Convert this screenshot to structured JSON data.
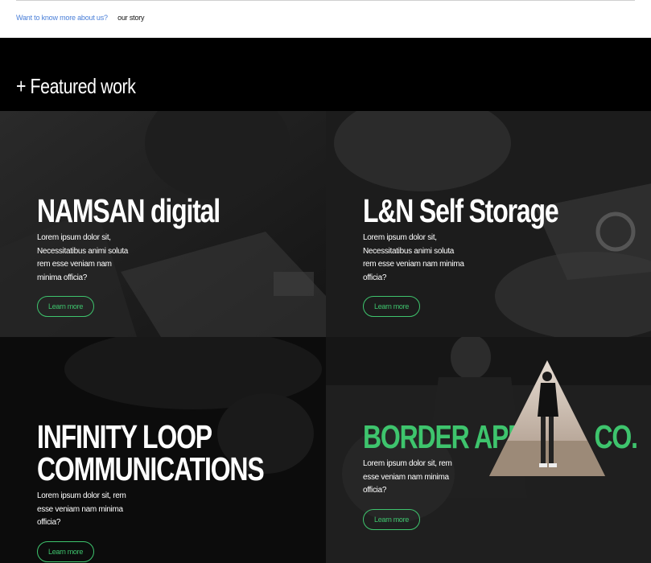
{
  "topbar": {
    "ask": "Want to know more about us?",
    "story": "our story"
  },
  "section": {
    "heading": "+ Featured work"
  },
  "cards": [
    {
      "title_lines": [
        "NAMSAN digital"
      ],
      "desc_lines": [
        "Lorem ipsum dolor sit,",
        "Necessitatibus animi soluta",
        "rem esse veniam nam",
        "minima officia?"
      ],
      "button": "Learn more"
    },
    {
      "title_lines": [
        "L&N Self Storage"
      ],
      "desc_lines": [
        "Lorem ipsum dolor sit,",
        "Necessitatibus animi soluta",
        "rem esse veniam nam minima",
        "officia?"
      ],
      "button": "Learn more"
    },
    {
      "title_lines": [
        "INFINITY LOOP",
        "COMMUNICATIONS"
      ],
      "desc_lines": [
        "Lorem ipsum dolor sit, rem",
        "esse veniam nam minima",
        "officia?"
      ],
      "button": "Learn more"
    },
    {
      "title_lines": [
        "BORDER APPAREL CO."
      ],
      "desc_lines": [
        "Lorem ipsum dolor sit, rem",
        "esse veniam nam minima",
        "officia?"
      ],
      "button": "Learn more"
    }
  ],
  "colors": {
    "accent": "#3ec46d",
    "link": "#4a7fd8"
  }
}
